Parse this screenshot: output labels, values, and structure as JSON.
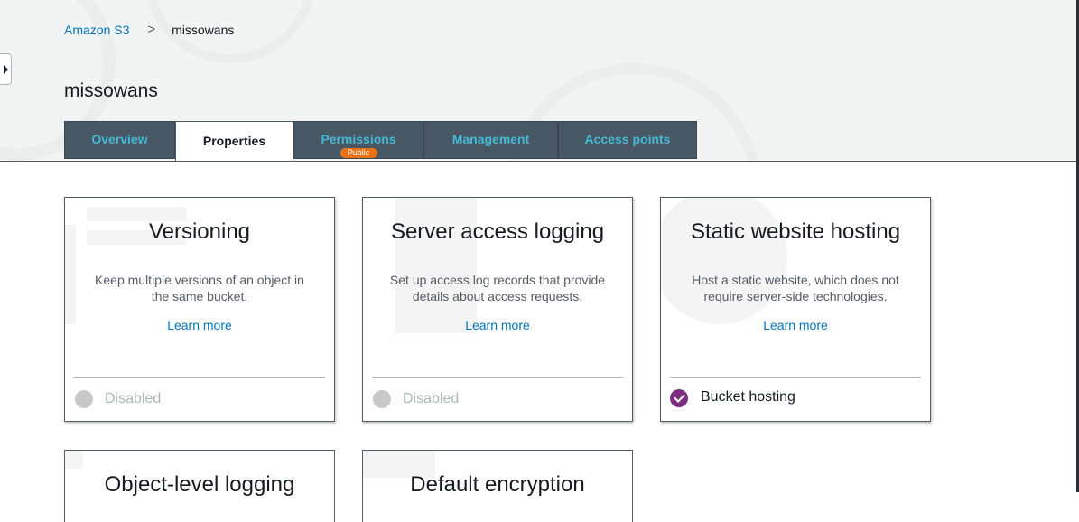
{
  "breadcrumb": {
    "root": "Amazon S3",
    "separator": ">",
    "current": "missowans"
  },
  "page": {
    "title": "missowans"
  },
  "tabs": [
    {
      "label": "Overview",
      "active": false
    },
    {
      "label": "Properties",
      "active": true
    },
    {
      "label": "Permissions",
      "active": false,
      "badge": "Public"
    },
    {
      "label": "Management",
      "active": false
    },
    {
      "label": "Access points",
      "active": false
    }
  ],
  "cards": [
    {
      "title": "Versioning",
      "description": "Keep multiple versions of an object in the same bucket.",
      "link": "Learn more",
      "status": "Disabled",
      "enabled": false
    },
    {
      "title": "Server access logging",
      "description": "Set up access log records that provide details about access requests.",
      "link": "Learn more",
      "status": "Disabled",
      "enabled": false
    },
    {
      "title": "Static website hosting",
      "description": "Host a static website, which does not require server-side technologies.",
      "link": "Learn more",
      "status": "Bucket hosting",
      "enabled": true
    },
    {
      "title": "Object-level logging"
    },
    {
      "title": "Default encryption"
    }
  ],
  "colors": {
    "link": "#0073bb",
    "tab_background": "#485764",
    "tab_text": "#44b9d6",
    "badge": "#ec7211",
    "status_enabled": "#7b2d82",
    "status_disabled": "#c8c8c8"
  },
  "icons": {
    "sidebar_toggle": "caret-right-icon",
    "status_enabled": "check-circle-icon",
    "status_disabled": "disabled-circle-icon"
  }
}
